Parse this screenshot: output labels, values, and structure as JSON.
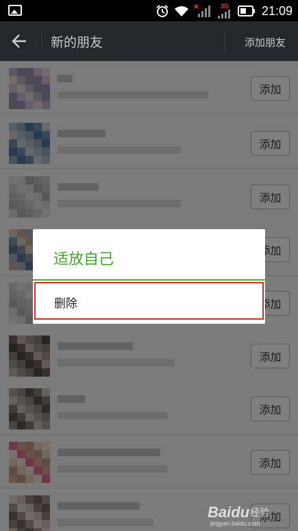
{
  "status_bar": {
    "time": "21:09",
    "network_label": "3G",
    "icons": [
      "image-notification-icon",
      "alarm-icon",
      "wifi-icon",
      "signal-icon",
      "battery-icon"
    ]
  },
  "action_bar": {
    "title": "新的朋友",
    "action": "添加朋友"
  },
  "list": {
    "rows": [
      {
        "button": "添加"
      },
      {
        "button": "添加"
      },
      {
        "button": "添加"
      },
      {
        "button": "添加"
      },
      {
        "button": "添加"
      },
      {
        "button": "添加"
      },
      {
        "button": "添加"
      },
      {
        "button": "添加"
      },
      {
        "button": "添加"
      }
    ]
  },
  "dialog": {
    "title": "适放自己",
    "item": "删除"
  },
  "watermark": {
    "logo": "Baidu",
    "text": "经验",
    "url": "jingyan.baidu.com"
  },
  "colors": {
    "accent_green": "#42a52a",
    "highlight_red": "#e0262b",
    "action_bar_bg": "#22292c"
  }
}
